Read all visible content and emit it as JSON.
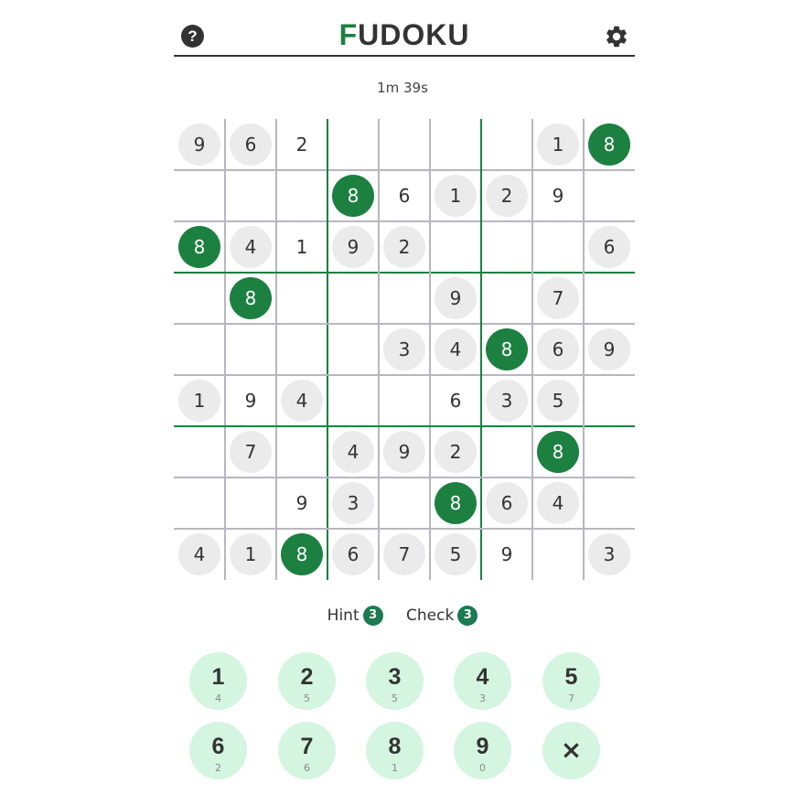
{
  "header": {
    "title_first": "F",
    "title_rest": "UDOKU",
    "help_label": "?",
    "help_icon": "question-circle-icon",
    "settings_icon": "gear-icon"
  },
  "timer": "1m 39s",
  "board": {
    "highlight_value": "8",
    "rows": [
      [
        "9",
        "6",
        "2",
        "",
        "",
        "",
        "",
        "1",
        "8"
      ],
      [
        "",
        "",
        "",
        "8",
        "6",
        "1",
        "2",
        "9",
        ""
      ],
      [
        "8",
        "4",
        "1",
        "9",
        "2",
        "",
        "",
        "",
        "6"
      ],
      [
        "",
        "8",
        "",
        "",
        "",
        "9",
        "",
        "7",
        ""
      ],
      [
        "",
        "",
        "",
        "",
        "3",
        "4",
        "8",
        "6",
        "9"
      ],
      [
        "1",
        "9",
        "4",
        "",
        "",
        "6",
        "3",
        "5",
        ""
      ],
      [
        "",
        "7",
        "",
        "4",
        "9",
        "2",
        "",
        "8",
        ""
      ],
      [
        "",
        "",
        "9",
        "3",
        "",
        "8",
        "6",
        "4",
        ""
      ],
      [
        "4",
        "1",
        "8",
        "6",
        "7",
        "5",
        "9",
        "",
        "3"
      ]
    ],
    "given": [
      [
        1,
        1,
        0,
        0,
        0,
        0,
        0,
        1,
        1
      ],
      [
        0,
        0,
        0,
        1,
        0,
        1,
        1,
        0,
        0
      ],
      [
        1,
        1,
        0,
        1,
        1,
        0,
        0,
        0,
        1
      ],
      [
        0,
        1,
        0,
        0,
        0,
        1,
        0,
        1,
        0
      ],
      [
        0,
        0,
        0,
        0,
        1,
        1,
        1,
        1,
        1
      ],
      [
        1,
        0,
        1,
        0,
        0,
        0,
        1,
        1,
        0
      ],
      [
        0,
        1,
        0,
        1,
        1,
        1,
        0,
        1,
        0
      ],
      [
        0,
        0,
        0,
        1,
        0,
        1,
        1,
        1,
        0
      ],
      [
        1,
        1,
        1,
        1,
        1,
        1,
        0,
        0,
        1
      ]
    ]
  },
  "helpers": {
    "hint_label": "Hint",
    "hint_count": "3",
    "check_label": "Check",
    "check_count": "3"
  },
  "keypad": [
    {
      "digit": "1",
      "remaining": "4"
    },
    {
      "digit": "2",
      "remaining": "5"
    },
    {
      "digit": "3",
      "remaining": "5"
    },
    {
      "digit": "4",
      "remaining": "3"
    },
    {
      "digit": "5",
      "remaining": "7"
    },
    {
      "digit": "6",
      "remaining": "2"
    },
    {
      "digit": "7",
      "remaining": "6"
    },
    {
      "digit": "8",
      "remaining": "1"
    },
    {
      "digit": "9",
      "remaining": "0"
    }
  ],
  "erase_label": "×",
  "colors": {
    "accent": "#1b8040",
    "given_bg": "#ebebeb",
    "key_bg": "#d4f5e0",
    "grid_line": "#b9b6c0"
  }
}
